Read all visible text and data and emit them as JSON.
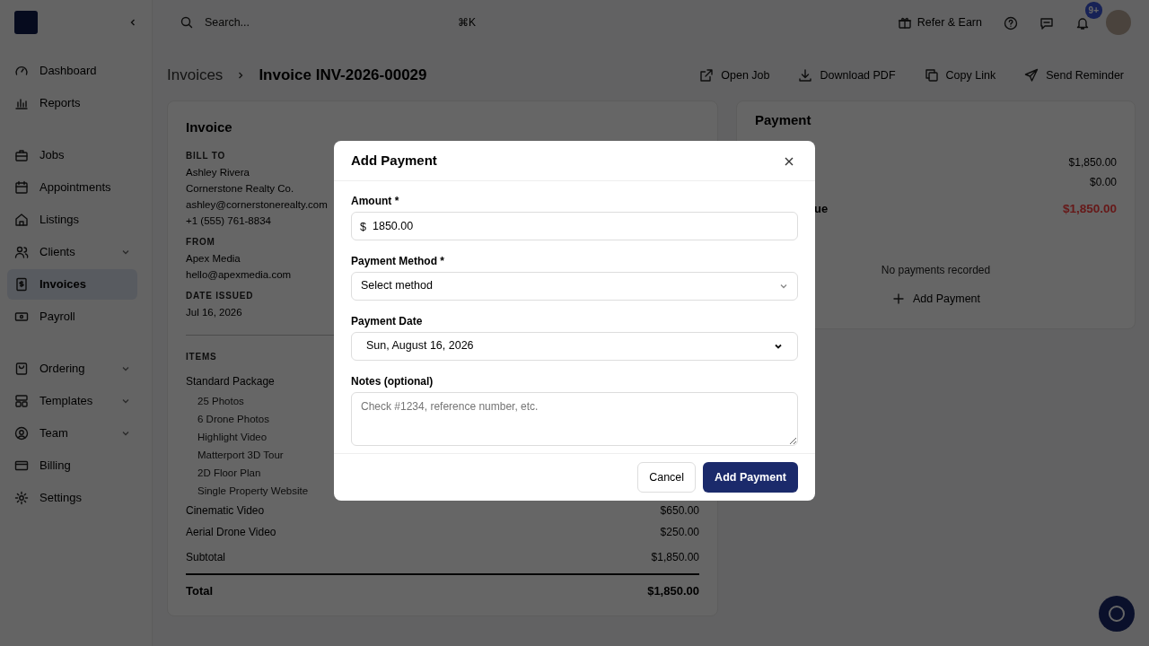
{
  "sidebar": {
    "sections": [
      {
        "items": [
          {
            "label": "Dashboard",
            "selected": false,
            "expandable": false
          },
          {
            "label": "Reports",
            "selected": false,
            "expandable": false
          }
        ]
      },
      {
        "items": [
          {
            "label": "Jobs",
            "selected": false,
            "expandable": false
          },
          {
            "label": "Appointments",
            "selected": false,
            "expandable": false
          },
          {
            "label": "Listings",
            "selected": false,
            "expandable": false
          },
          {
            "label": "Clients",
            "selected": false,
            "expandable": true
          },
          {
            "label": "Invoices",
            "selected": true,
            "expandable": false
          },
          {
            "label": "Payroll",
            "selected": false,
            "expandable": false
          }
        ]
      },
      {
        "items": [
          {
            "label": "Ordering",
            "selected": false,
            "expandable": true
          },
          {
            "label": "Templates",
            "selected": false,
            "expandable": true
          },
          {
            "label": "Team",
            "selected": false,
            "expandable": true
          },
          {
            "label": "Billing",
            "selected": false,
            "expandable": false
          },
          {
            "label": "Settings",
            "selected": false,
            "expandable": false
          }
        ]
      }
    ]
  },
  "topbar": {
    "search": {
      "placeholder": "Search...",
      "shortcut": "⌘K"
    },
    "refer": "Refer & Earn",
    "notification_badge": "9+"
  },
  "breadcrumb": [
    "Invoices",
    "Invoice INV-2026-00029"
  ],
  "actions": [
    "Open Job",
    "Download PDF",
    "Copy Link",
    "Send Reminder"
  ],
  "invoice": {
    "title": "Invoice",
    "sections": [
      {
        "heading": "BILL TO",
        "lines": [
          "Ashley Rivera",
          "Cornerstone Realty Co.",
          "ashley@cornerstonerealty.com",
          "+1 (555) 761-8834"
        ]
      },
      {
        "heading": "FROM",
        "lines": [
          "Apex Media",
          "hello@apexmedia.com"
        ]
      },
      {
        "heading": "DATE ISSUED",
        "lines": [
          "Jul 16, 2026"
        ]
      }
    ],
    "items_heading": "ITEMS",
    "items": [
      {
        "name": "Standard Package",
        "children": [
          "25 Photos",
          "6 Drone Photos",
          "Highlight Video",
          "Matterport 3D Tour",
          "2D Floor Plan",
          "Single Property Website"
        ]
      },
      {
        "name": "Cinematic Video",
        "price": "$650.00"
      },
      {
        "name": "Aerial Drone Video",
        "price": "$250.00"
      }
    ],
    "subtotal": {
      "label": "Subtotal",
      "value": "$1,850.00"
    },
    "total": {
      "label": "Total",
      "value": "$1,850.00"
    }
  },
  "payment": {
    "title": "Payment",
    "rows": [
      {
        "value": "$1,850.00",
        "kind": "normal"
      },
      {
        "value": "$0.00",
        "kind": "normal"
      },
      {
        "label": "ue",
        "value": "$1,850.00",
        "kind": "due"
      }
    ],
    "empty_text": "No payments recorded",
    "add_button": "Add Payment"
  },
  "modal": {
    "title": "Add Payment",
    "amount": {
      "label": "Amount *",
      "prefix": "$",
      "value": "1850.00"
    },
    "method": {
      "label": "Payment Method *",
      "value": "Select method"
    },
    "date": {
      "label": "Payment Date",
      "value": "Sun, August 16, 2026"
    },
    "notes": {
      "label": "Notes (optional)",
      "placeholder": "Check #1234, reference number, etc."
    },
    "buttons": [
      "Cancel",
      "Add Payment"
    ]
  }
}
